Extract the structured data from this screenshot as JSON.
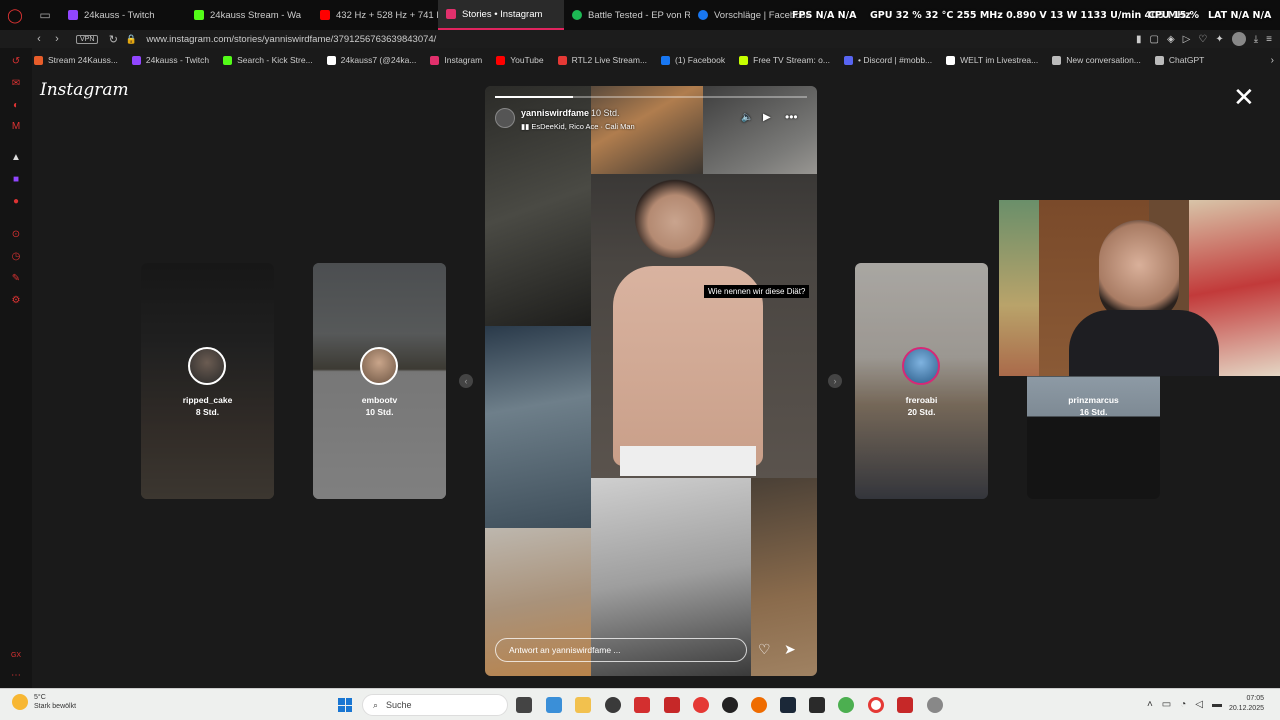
{
  "browser": {
    "tabs": [
      {
        "label": "24kauss - Twitch",
        "color": "#9146ff"
      },
      {
        "label": "24kauss Stream - Wa",
        "color": "#53fc18"
      },
      {
        "label": "432 Hz + 528 Hz + 741 H",
        "color": "#ff0000"
      },
      {
        "label": "Stories • Instagram",
        "color": "#e1306c",
        "active": true
      },
      {
        "label": "Battle Tested - EP von Ro",
        "color": "#1db954"
      },
      {
        "label": "Vorschläge | Facebook",
        "color": "#1877f2"
      }
    ],
    "url": "www.instagram.com/stories/yanniswirdfame/3791256763639843074/",
    "vpn_label": "VPN"
  },
  "osd": {
    "fps": "FPS  N/A  N/A",
    "gpu": "GPU  32 %  32 °C  255 MHz  0.890 V  13 W  1133 U/min  405 MHz",
    "cpu": "CPU  15 %",
    "lat": "LAT  N/A  N/A"
  },
  "bookmarks": [
    {
      "label": "Stream 24Kauss...",
      "color": "#e85d2a"
    },
    {
      "label": "24kauss - Twitch",
      "color": "#9146ff"
    },
    {
      "label": "Search - Kick Stre...",
      "color": "#53fc18"
    },
    {
      "label": "24kauss7 (@24ka...",
      "color": "#ffffff"
    },
    {
      "label": "Instagram",
      "color": "#e1306c"
    },
    {
      "label": "YouTube",
      "color": "#ff0000"
    },
    {
      "label": "RTL2 Live Stream...",
      "color": "#e53935"
    },
    {
      "label": "(1) Facebook",
      "color": "#1877f2"
    },
    {
      "label": "Free TV Stream: o...",
      "color": "#c6ff00"
    },
    {
      "label": "• Discord | #mobb...",
      "color": "#5865f2"
    },
    {
      "label": "WELT im Livestrea...",
      "color": "#ffffff"
    },
    {
      "label": "New conversation...",
      "color": "#bbbbbb"
    },
    {
      "label": "ChatGPT",
      "color": "#bbbbbb"
    }
  ],
  "page": {
    "logo": "Instagram"
  },
  "side_stories": [
    {
      "name": "ripped_cake",
      "time": "8 Std."
    },
    {
      "name": "embootv",
      "time": "10 Std."
    },
    {
      "name": "freroabi",
      "time": "20 Std."
    },
    {
      "name": "prinzmarcus",
      "time": "16 Std."
    }
  ],
  "story": {
    "username": "yanniswirdfame",
    "time": "10 Std.",
    "music": "EsDeeKid, Rico Ace · Cali Man",
    "caption": "Wie nennen wir diese Diät?",
    "reply_placeholder": "Antwort an yanniswirdfame ...",
    "progress": 0.25
  },
  "taskbar": {
    "temp": "5°C",
    "weather": "Stark bewölkt",
    "search": "Suche",
    "time": "07:05",
    "date": "20.12.2025"
  }
}
